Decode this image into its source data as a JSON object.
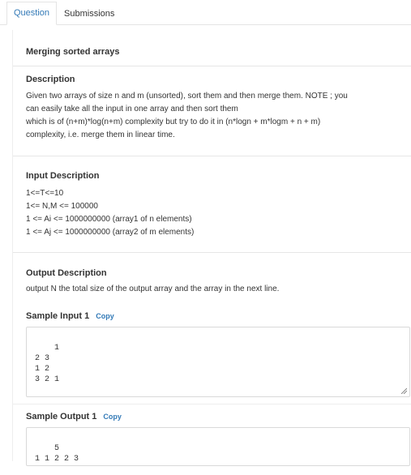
{
  "tabs": [
    {
      "label": "Question"
    },
    {
      "label": "Submissions"
    }
  ],
  "problem": {
    "title": "Merging sorted arrays",
    "description_heading": "Description",
    "description_text": "Given two arrays of size n and m (unsorted), sort them and then merge them. NOTE ; you\ncan easily take all the input in one array and then sort them\nwhich is of (n+m)*log(n+m) complexity but try to do it in (n*logn + m*logm + n + m)\ncomplexity, i.e. merge them in linear time.",
    "input_heading": "Input Description",
    "input_text": "1<=T<=10\n1<= N,M <= 100000\n1 <= Ai <= 1000000000 (array1 of n elements)\n1 <= Aj <= 1000000000 (array2 of m elements)",
    "output_heading": "Output Description",
    "output_text": "output N the total size of the output array and the array in the next line.",
    "sample_input_label": "Sample Input 1",
    "sample_input_copy": "Copy",
    "sample_input_value": "1\n2 3\n1 2\n3 2 1",
    "sample_output_label": "Sample Output 1",
    "sample_output_copy": "Copy",
    "sample_output_value": "5\n1 1 2 2 3"
  }
}
